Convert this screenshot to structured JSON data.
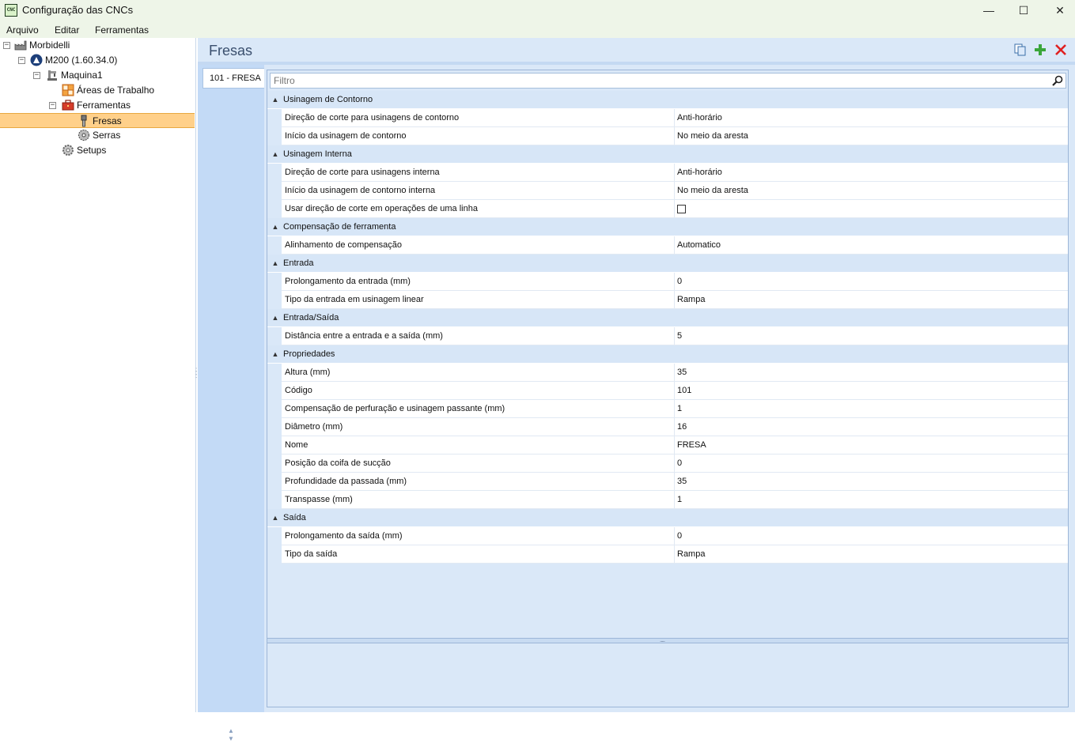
{
  "window": {
    "title": "Configuração das CNCs",
    "icon_text": "CNC",
    "controls": {
      "minimize": "—",
      "maximize": "☐",
      "close": "✕"
    }
  },
  "menu": [
    "Arquivo",
    "Editar",
    "Ferramentas"
  ],
  "tree": {
    "items": [
      {
        "label": "Morbidelli",
        "expander": "−"
      },
      {
        "label": "M200 (1.60.34.0)",
        "expander": "−"
      },
      {
        "label": "Maquina1",
        "expander": "−"
      },
      {
        "label": "Áreas de Trabalho"
      },
      {
        "label": "Ferramentas",
        "expander": "−"
      },
      {
        "label": "Fresas"
      },
      {
        "label": "Serras"
      },
      {
        "label": "Setups"
      }
    ]
  },
  "panel": {
    "title": "Fresas",
    "tab": "101 - FRESA",
    "filter_placeholder": "Filtro"
  },
  "categories": [
    {
      "label": "Usinagem de Contorno",
      "toggle": "▲",
      "props": [
        {
          "name": "Direção de corte para usinagens de contorno",
          "value": "Anti-horário"
        },
        {
          "name": "Início da usinagem de contorno",
          "value": "No meio da aresta"
        }
      ]
    },
    {
      "label": "Usinagem Interna",
      "toggle": "▲",
      "props": [
        {
          "name": "Direção de corte para usinagens interna",
          "value": "Anti-horário"
        },
        {
          "name": "Início da usinagem de contorno interna",
          "value": "No meio da aresta"
        },
        {
          "name": "Usar direção de corte em operações de uma linha",
          "checkbox": true,
          "checked": false
        }
      ]
    },
    {
      "label": "Compensação de ferramenta",
      "toggle": "▲",
      "props": [
        {
          "name": "Alinhamento de compensação",
          "value": "Automatico"
        }
      ]
    },
    {
      "label": "Entrada",
      "toggle": "▲",
      "props": [
        {
          "name": "Prolongamento da entrada (mm)",
          "value": "0"
        },
        {
          "name": "Tipo da entrada em usinagem linear",
          "value": "Rampa"
        }
      ]
    },
    {
      "label": "Entrada/Saída",
      "toggle": "▲",
      "props": [
        {
          "name": "Distância entre a entrada e a saída (mm)",
          "value": "5"
        }
      ]
    },
    {
      "label": "Propriedades",
      "toggle": "▲",
      "props": [
        {
          "name": "Altura (mm)",
          "value": "35"
        },
        {
          "name": "Código",
          "value": "101"
        },
        {
          "name": "Compensação de perfuração e usinagem passante (mm)",
          "value": "1"
        },
        {
          "name": "Diâmetro (mm)",
          "value": "16"
        },
        {
          "name": "Nome",
          "value": "FRESA"
        },
        {
          "name": "Posição da coifa de sucção",
          "value": "0"
        },
        {
          "name": "Profundidade da passada (mm)",
          "value": "35"
        },
        {
          "name": "Transpasse (mm)",
          "value": "1"
        }
      ]
    },
    {
      "label": "Saída",
      "toggle": "▲",
      "props": [
        {
          "name": "Prolongamento da saída (mm)",
          "value": "0"
        },
        {
          "name": "Tipo da saída",
          "value": "Rampa"
        }
      ]
    }
  ],
  "colors": {
    "selection": "#ffd08a",
    "panel": "#dae8f8",
    "category": "#d7e6f7",
    "add": "#3aa63a",
    "delete": "#e02020"
  }
}
